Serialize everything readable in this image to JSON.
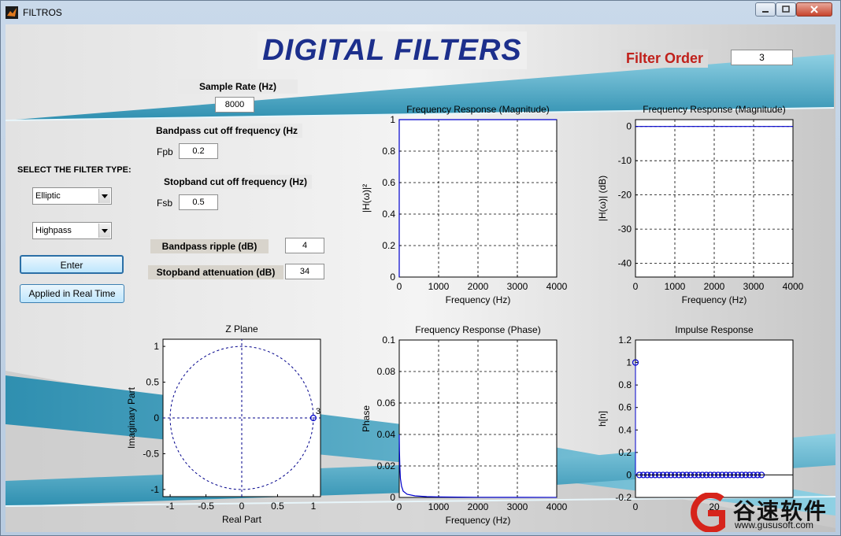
{
  "window": {
    "title": "FILTROS"
  },
  "header": {
    "banner": "DIGITAL FILTERS",
    "filter_order_label": "Filter Order",
    "filter_order_value": "3"
  },
  "controls": {
    "sample_rate_label": "Sample Rate (Hz)",
    "sample_rate_value": "8000",
    "bandpass_cutoff_label": "Bandpass cut off frequency (Hz",
    "fpb_label": "Fpb",
    "fpb_value": "0.2",
    "stopband_cutoff_label": "Stopband cut off frequency (Hz)",
    "fsb_label": "Fsb",
    "fsb_value": "0.5",
    "select_type_label": "SELECT THE FILTER TYPE:",
    "filter_design": "Elliptic",
    "filter_band": "Highpass",
    "enter_button": "Enter",
    "realtime_button": "Applied in Real Time",
    "bandpass_ripple_label": "Bandpass ripple (dB)",
    "bandpass_ripple_value": "4",
    "stopband_atten_label": "Stopband attenuation (dB)",
    "stopband_atten_value": "34"
  },
  "watermark": {
    "text": "谷速软件",
    "url": "www.gususoft.com"
  },
  "colors": {
    "plot_line": "#0000cc",
    "banner_text": "#1c2f8c",
    "filter_order_text": "#c0201b",
    "teal": "#3ea0bd"
  },
  "chart_data": [
    {
      "id": "mag-linear",
      "type": "line",
      "title": "Frequency Response (Magnitude)",
      "xlabel": "Frequency (Hz)",
      "ylabel": "|H(ω)|²",
      "xlim": [
        0,
        4000
      ],
      "ylim": [
        0,
        1
      ],
      "xticks": [
        0,
        1000,
        2000,
        3000,
        4000
      ],
      "yticks": [
        0,
        0.2,
        0.4,
        0.6,
        0.8,
        1
      ],
      "ytick_labels": [
        "0",
        "0.2",
        "0.4",
        "0.6",
        "0.8",
        "1"
      ],
      "grid": true,
      "series": [
        {
          "x": [
            0,
            0,
            4000
          ],
          "y": [
            0,
            1,
            1
          ]
        }
      ]
    },
    {
      "id": "mag-db",
      "type": "line",
      "title": "Frequency Response (Magnitude)",
      "xlabel": "Frequency (Hz)",
      "ylabel": "|H(ω)| (dB)",
      "xlim": [
        0,
        4000
      ],
      "ylim": [
        -44,
        2
      ],
      "xticks": [
        0,
        1000,
        2000,
        3000,
        4000
      ],
      "yticks": [
        0,
        -10,
        -20,
        -30,
        -40
      ],
      "ytick_labels": [
        "0",
        "-10",
        "-20",
        "-30",
        "-40"
      ],
      "grid": true,
      "series": [
        {
          "x": [
            0,
            4000
          ],
          "y": [
            0,
            0
          ]
        }
      ]
    },
    {
      "id": "zplane",
      "type": "scatter",
      "title": "Z Plane",
      "xlabel": "Real Part",
      "ylabel": "Imaginary Part",
      "xlim": [
        -1.1,
        1.1
      ],
      "ylim": [
        -1.1,
        1.1
      ],
      "xticks": [
        -1,
        -0.5,
        0,
        0.5,
        1
      ],
      "yticks": [
        -1,
        -0.5,
        0,
        0.5,
        1
      ],
      "ytick_labels": [
        "-1",
        "-0.5",
        "0",
        "0.5",
        "1"
      ],
      "grid": false,
      "unit_circle": true,
      "points": [
        {
          "x": 1,
          "y": 0,
          "marker": "zero",
          "label": "3"
        }
      ]
    },
    {
      "id": "phase",
      "type": "line",
      "title": "Frequency Response (Phase)",
      "xlabel": "Frequency (Hz)",
      "ylabel": "Phase",
      "xlim": [
        0,
        4000
      ],
      "ylim": [
        0,
        0.1
      ],
      "xticks": [
        0,
        1000,
        2000,
        3000,
        4000
      ],
      "yticks": [
        0,
        0.02,
        0.04,
        0.06,
        0.08,
        0.1
      ],
      "ytick_labels": [
        "0",
        "0.02",
        "0.04",
        "0.06",
        "0.08",
        "0.1"
      ],
      "grid": true,
      "series": [
        {
          "x": [
            0,
            5,
            15,
            30,
            60,
            100,
            200,
            400,
            700,
            1000,
            1500,
            2000,
            3000,
            4000
          ],
          "y": [
            0.04,
            0.03,
            0.02,
            0.012,
            0.007,
            0.004,
            0.002,
            0.001,
            0.0005,
            0.0003,
            0.0002,
            0.0001,
            5e-05,
            3e-05
          ]
        }
      ]
    },
    {
      "id": "impulse",
      "type": "scatter",
      "title": "Impulse Response",
      "xlabel": "n",
      "ylabel": "h[n]",
      "xlim": [
        0,
        40
      ],
      "ylim": [
        -0.2,
        1.2
      ],
      "xticks": [
        0,
        20
      ],
      "yticks": [
        -0.2,
        0,
        0.2,
        0.4,
        0.6,
        0.8,
        1,
        1.2
      ],
      "ytick_labels": [
        "-0.2",
        "0",
        "0.2",
        "0.4",
        "0.6",
        "0.8",
        "1",
        "1.2"
      ],
      "grid": false,
      "points": [
        {
          "x": 0,
          "y": 1
        },
        {
          "x": 1,
          "y": 0
        },
        {
          "x": 2,
          "y": 0
        },
        {
          "x": 3,
          "y": 0
        },
        {
          "x": 4,
          "y": 0
        },
        {
          "x": 5,
          "y": 0
        },
        {
          "x": 6,
          "y": 0
        },
        {
          "x": 7,
          "y": 0
        },
        {
          "x": 8,
          "y": 0
        },
        {
          "x": 9,
          "y": 0
        },
        {
          "x": 10,
          "y": 0
        },
        {
          "x": 11,
          "y": 0
        },
        {
          "x": 12,
          "y": 0
        },
        {
          "x": 13,
          "y": 0
        },
        {
          "x": 14,
          "y": 0
        },
        {
          "x": 15,
          "y": 0
        },
        {
          "x": 16,
          "y": 0
        },
        {
          "x": 17,
          "y": 0
        },
        {
          "x": 18,
          "y": 0
        },
        {
          "x": 19,
          "y": 0
        },
        {
          "x": 20,
          "y": 0
        },
        {
          "x": 21,
          "y": 0
        },
        {
          "x": 22,
          "y": 0
        },
        {
          "x": 23,
          "y": 0
        },
        {
          "x": 24,
          "y": 0
        },
        {
          "x": 25,
          "y": 0
        },
        {
          "x": 26,
          "y": 0
        },
        {
          "x": 27,
          "y": 0
        },
        {
          "x": 28,
          "y": 0
        },
        {
          "x": 29,
          "y": 0
        },
        {
          "x": 30,
          "y": 0
        },
        {
          "x": 31,
          "y": 0
        },
        {
          "x": 32,
          "y": 0
        }
      ]
    }
  ]
}
